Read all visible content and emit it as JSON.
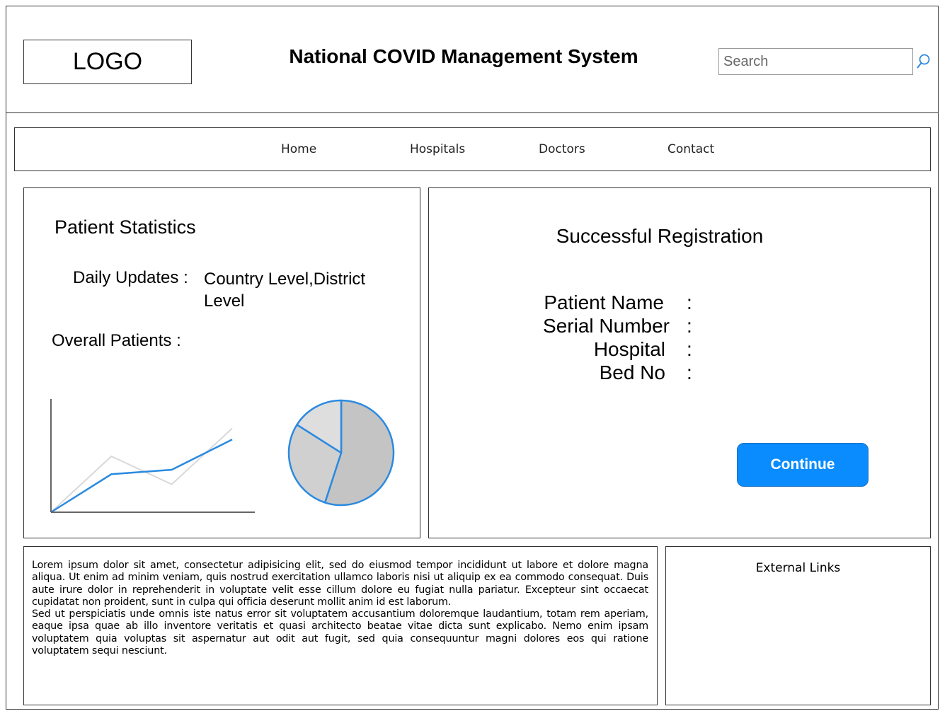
{
  "header": {
    "logo": "LOGO",
    "title": "National COVID Management System",
    "search_placeholder": "Search"
  },
  "nav": {
    "items": [
      {
        "label": "Home"
      },
      {
        "label": "Hospitals"
      },
      {
        "label": "Doctors"
      },
      {
        "label": "Contact"
      }
    ]
  },
  "stats": {
    "title": "Patient Statistics",
    "daily_label": "Daily Updates :",
    "daily_value": "Country Level,District Level",
    "overall_label": "Overall Patients :"
  },
  "chart_data": [
    {
      "type": "line",
      "x": [
        0,
        1,
        2,
        3
      ],
      "series": [
        {
          "values": [
            0,
            34,
            38,
            65
          ],
          "color": "#2b8ae0"
        },
        {
          "values": [
            0,
            50,
            25,
            75
          ],
          "color": "#d9d9d9"
        }
      ],
      "ylim": [
        0,
        100
      ],
      "colors": {
        "axis": "#666666"
      }
    },
    {
      "type": "pie",
      "values": [
        55,
        29,
        16
      ],
      "colors": [
        "#c4c4c4",
        "#d0d0d0",
        "#dedede"
      ],
      "stroke": "#2b8ae0"
    }
  ],
  "registration": {
    "title": "Successful Registration",
    "fields": [
      {
        "label": "Patient Name",
        "sep": ":"
      },
      {
        "label": "Serial Number",
        "sep": ":"
      },
      {
        "label": "Hospital",
        "sep": ":"
      },
      {
        "label": "Bed No",
        "sep": ":"
      }
    ],
    "continue_label": "Continue"
  },
  "footer": {
    "lorem_1": "Lorem ipsum dolor sit amet, consectetur adipisicing elit, sed do eiusmod tempor incididunt ut labore et dolore magna aliqua. Ut enim ad minim veniam, quis nostrud exercitation ullamco laboris nisi ut aliquip ex ea commodo consequat. Duis aute irure dolor in reprehenderit in voluptate velit esse cillum dolore eu fugiat nulla pariatur. Excepteur sint occaecat cupidatat non proident, sunt in culpa qui officia deserunt mollit anim id est laborum.",
    "lorem_2": "Sed ut perspiciatis unde omnis iste natus error sit voluptatem accusantium doloremque laudantium, totam rem aperiam, eaque ipsa quae ab illo inventore veritatis et quasi architecto beatae vitae dicta sunt explicabo. Nemo enim ipsam voluptatem quia voluptas sit aspernatur aut odit aut fugit, sed quia consequuntur magni dolores eos qui ratione voluptatem sequi nesciunt.",
    "external_links": "External Links"
  },
  "colors": {
    "accent": "#0a8cff",
    "chart_line": "#2b8ae0"
  }
}
